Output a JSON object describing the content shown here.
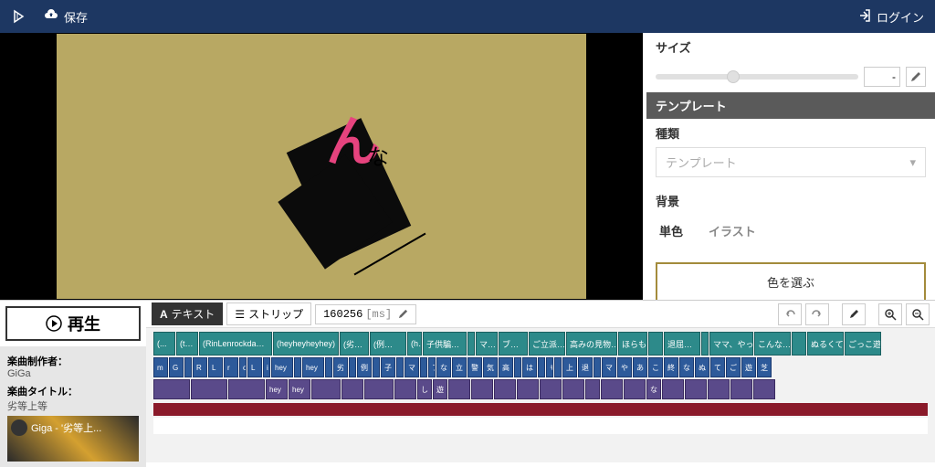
{
  "topbar": {
    "save_label": "保存",
    "login_label": "ログイン"
  },
  "right_panel": {
    "size_label": "サイズ",
    "size_value": "-",
    "template_header": "テンプレート",
    "type_label": "種類",
    "dropdown_placeholder": "テンプレート",
    "background_label": "背景",
    "tab_solid": "単色",
    "tab_illust": "イラスト",
    "color_select_label": "色を選ぶ"
  },
  "bottom": {
    "play_label": "再生",
    "creator_label": "楽曲制作者：",
    "creator_value": "GiGa",
    "title_label": "楽曲タイトル：",
    "title_value": "劣等上等",
    "thumb_title": "Giga - '劣等上..."
  },
  "timeline": {
    "text_btn": "テキスト",
    "strip_btn": "ストリップ",
    "time_value": "160256",
    "time_unit": "[ms]",
    "track1": [
      {
        "w": 3,
        "t": "(..."
      },
      {
        "w": 3,
        "t": "(t…"
      },
      {
        "w": 10,
        "t": "(RinLenrockda…"
      },
      {
        "w": 9,
        "t": "(heyheyheyhey)"
      },
      {
        "w": 4,
        "t": "(劣…"
      },
      {
        "w": 5,
        "t": "(例…"
      },
      {
        "w": 2,
        "t": "(h…"
      },
      {
        "w": 6,
        "t": "子供騙…"
      },
      {
        "w": 1,
        "t": ""
      },
      {
        "w": 3,
        "t": "マ…"
      },
      {
        "w": 4,
        "t": "ブ…"
      },
      {
        "w": 5,
        "t": "ご立派…"
      },
      {
        "w": 7,
        "t": "高みの見物…"
      },
      {
        "w": 4,
        "t": "ほらも…"
      },
      {
        "w": 2,
        "t": ""
      },
      {
        "w": 5,
        "t": "退屈…"
      },
      {
        "w": 1,
        "t": ""
      },
      {
        "w": 6,
        "t": "ママ、やっ…"
      },
      {
        "w": 5,
        "t": "こんな…"
      },
      {
        "w": 2,
        "t": ""
      },
      {
        "w": 5,
        "t": "ぬるくて…"
      },
      {
        "w": 5,
        "t": "ごっこ遊"
      }
    ],
    "track2": [
      {
        "w": 2,
        "t": "m"
      },
      {
        "w": 2,
        "t": "G"
      },
      {
        "w": 1,
        "t": ""
      },
      {
        "w": 2,
        "t": "R"
      },
      {
        "w": 2,
        "t": "L"
      },
      {
        "w": 2,
        "t": "r"
      },
      {
        "w": 1,
        "t": "o"
      },
      {
        "w": 2,
        "t": "L"
      },
      {
        "w": 1,
        "t": "i"
      },
      {
        "w": 3,
        "t": "hey"
      },
      {
        "w": 1,
        "t": ""
      },
      {
        "w": 3,
        "t": "hey"
      },
      {
        "w": 1,
        "t": ""
      },
      {
        "w": 2,
        "t": "劣"
      },
      {
        "w": 1,
        "t": ""
      },
      {
        "w": 2,
        "t": "例"
      },
      {
        "w": 1,
        "t": ""
      },
      {
        "w": 2,
        "t": "子"
      },
      {
        "w": 1,
        "t": ""
      },
      {
        "w": 2,
        "t": "マ"
      },
      {
        "w": 1,
        "t": ""
      },
      {
        "w": 1,
        "t": "ブ"
      },
      {
        "w": 2,
        "t": "な"
      },
      {
        "w": 2,
        "t": "立"
      },
      {
        "w": 2,
        "t": "警"
      },
      {
        "w": 2,
        "t": "気"
      },
      {
        "w": 2,
        "t": "高"
      },
      {
        "w": 1,
        "t": ""
      },
      {
        "w": 2,
        "t": "は"
      },
      {
        "w": 1,
        "t": ""
      },
      {
        "w": 1,
        "t": "も"
      },
      {
        "w": 1,
        "t": ""
      },
      {
        "w": 2,
        "t": "上"
      },
      {
        "w": 2,
        "t": "退"
      },
      {
        "w": 1,
        "t": ""
      },
      {
        "w": 2,
        "t": "マ"
      },
      {
        "w": 2,
        "t": "や"
      },
      {
        "w": 2,
        "t": "あ"
      },
      {
        "w": 2,
        "t": "こ"
      },
      {
        "w": 2,
        "t": "終"
      },
      {
        "w": 2,
        "t": "な"
      },
      {
        "w": 2,
        "t": "ぬ"
      },
      {
        "w": 2,
        "t": "て"
      },
      {
        "w": 2,
        "t": "ご"
      },
      {
        "w": 2,
        "t": "遊"
      },
      {
        "w": 2,
        "t": "芝"
      }
    ],
    "track3": [
      {
        "w": 5,
        "t": ""
      },
      {
        "w": 5,
        "t": ""
      },
      {
        "w": 5,
        "t": ""
      },
      {
        "w": 3,
        "t": "hey"
      },
      {
        "w": 3,
        "t": "hey"
      },
      {
        "w": 4,
        "t": ""
      },
      {
        "w": 3,
        "t": ""
      },
      {
        "w": 4,
        "t": ""
      },
      {
        "w": 3,
        "t": ""
      },
      {
        "w": 2,
        "t": "し"
      },
      {
        "w": 2,
        "t": "遊"
      },
      {
        "w": 3,
        "t": ""
      },
      {
        "w": 3,
        "t": ""
      },
      {
        "w": 3,
        "t": ""
      },
      {
        "w": 3,
        "t": ""
      },
      {
        "w": 3,
        "t": ""
      },
      {
        "w": 3,
        "t": ""
      },
      {
        "w": 2,
        "t": ""
      },
      {
        "w": 3,
        "t": ""
      },
      {
        "w": 3,
        "t": ""
      },
      {
        "w": 2,
        "t": "な"
      },
      {
        "w": 3,
        "t": ""
      },
      {
        "w": 3,
        "t": ""
      },
      {
        "w": 3,
        "t": ""
      },
      {
        "w": 3,
        "t": ""
      },
      {
        "w": 3,
        "t": ""
      }
    ]
  }
}
